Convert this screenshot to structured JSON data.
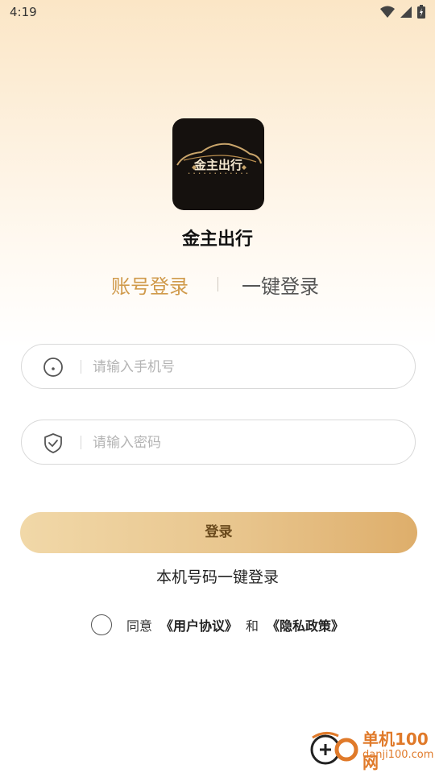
{
  "status_bar": {
    "time": "4:19"
  },
  "app": {
    "logo_text": "金主出行",
    "name": "金主出行"
  },
  "tabs": {
    "account": "账号登录",
    "onekey": "一键登录"
  },
  "form": {
    "phone_placeholder": "请输入手机号",
    "password_placeholder": "请输入密码",
    "login_button": "登录",
    "onekey_link": "本机号码一键登录"
  },
  "agreement": {
    "prefix": "同意",
    "user_agreement": "《用户协议》",
    "and": "和",
    "privacy_policy": "《隐私政策》"
  },
  "watermark": {
    "title": "单机100网",
    "url": "danji100.com"
  },
  "colors": {
    "accent": "#d09a4b",
    "button_start": "#f1d8a8",
    "button_end": "#deae6b"
  }
}
